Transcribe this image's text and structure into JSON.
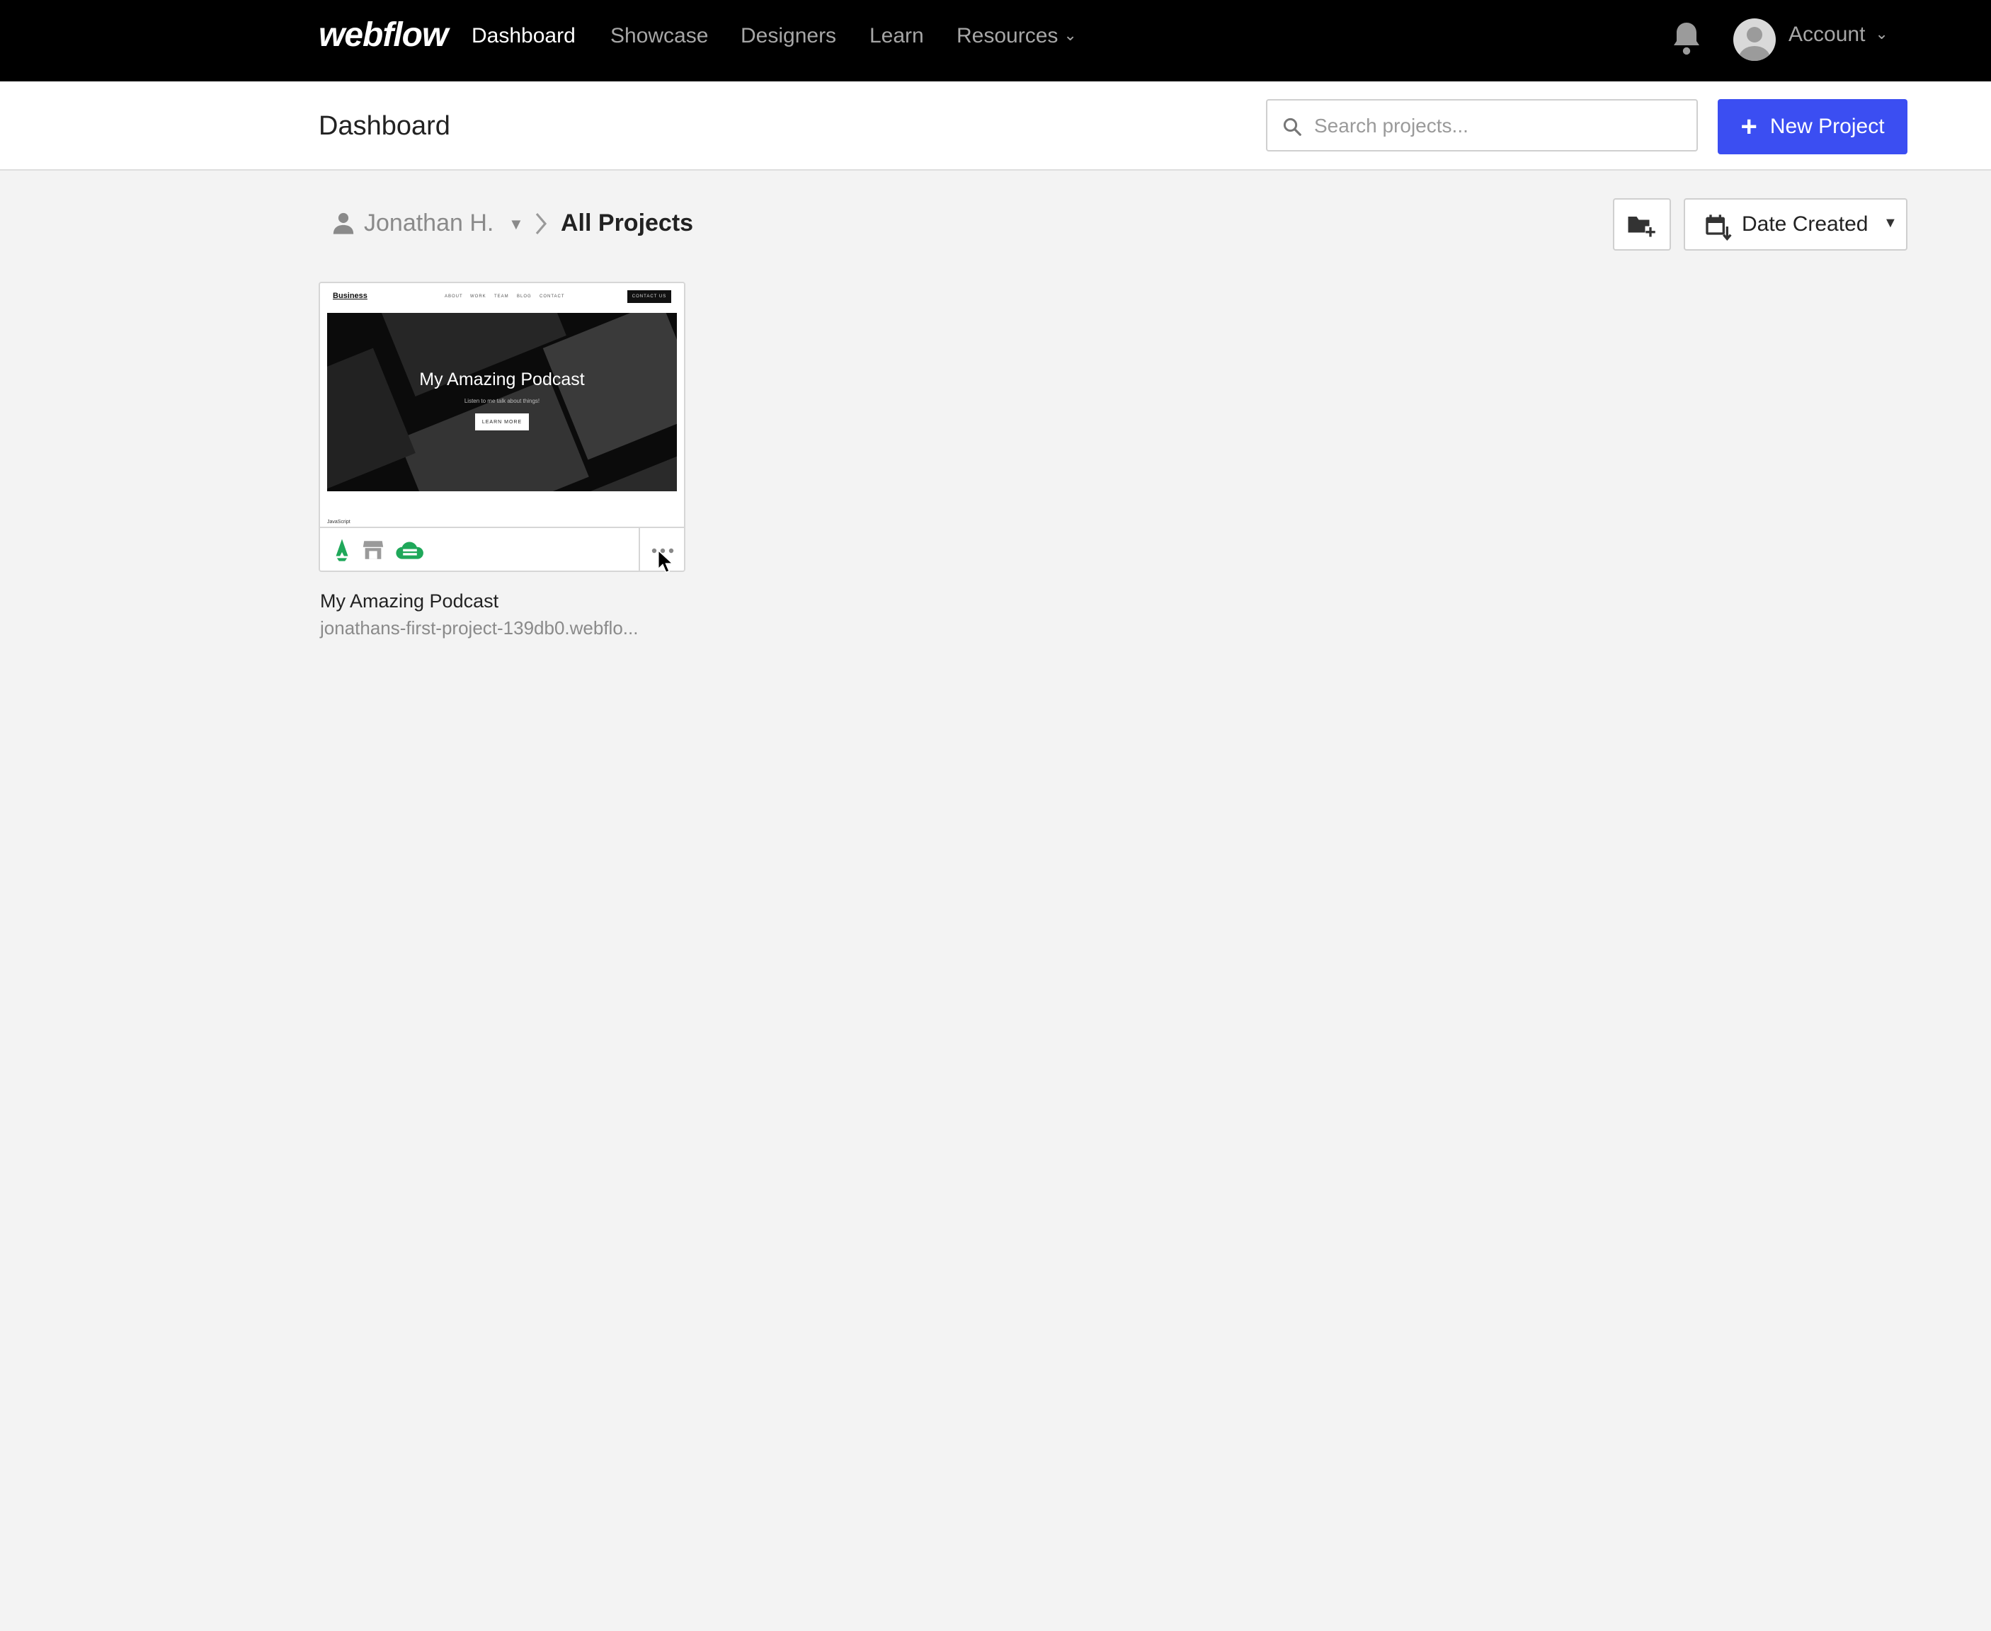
{
  "nav": {
    "logo": "webflow",
    "links": [
      {
        "label": "Dashboard",
        "active": true
      },
      {
        "label": "Showcase",
        "active": false
      },
      {
        "label": "Designers",
        "active": false
      },
      {
        "label": "Learn",
        "active": false
      },
      {
        "label": "Resources",
        "active": false
      }
    ],
    "account_label": "Account",
    "icons": {
      "notifications": "bell-icon",
      "avatar": "user-avatar",
      "resources": "chevron-down-icon",
      "account": "chevron-down-icon"
    }
  },
  "header": {
    "title": "Dashboard",
    "search": {
      "placeholder": "Search projects...",
      "value": ""
    },
    "new_project_label": "New Project"
  },
  "breadcrumb": {
    "user": "Jonathan H.",
    "current": "All Projects"
  },
  "toolbar": {
    "sort_label": "Date Created",
    "icons": {
      "new_folder": "folder-plus-icon",
      "sort": "calendar-sort-icon"
    }
  },
  "projects": [
    {
      "name": "My Amazing Podcast",
      "url": "jonathans-first-project-139db0.webflo...",
      "thumbnail": {
        "brand": "Business",
        "nav": [
          "ABOUT",
          "WORK",
          "TEAM",
          "BLOG",
          "CONTACT"
        ],
        "cta": "CONTACT US",
        "hero_title": "My Amazing Podcast",
        "hero_subtitle": "Listen to me talk about things!",
        "hero_button": "LEARN MORE",
        "footer": "JavaScript"
      },
      "status_icons": [
        "rocket-icon",
        "storefront-icon",
        "cloud-icon"
      ],
      "colors": {
        "status_green": "#1fa85a",
        "status_gray": "#9a9a9a"
      }
    }
  ],
  "colors": {
    "topnav_bg": "#000000",
    "accent": "#3b4ef2",
    "page_bg": "#f3f3f3"
  }
}
